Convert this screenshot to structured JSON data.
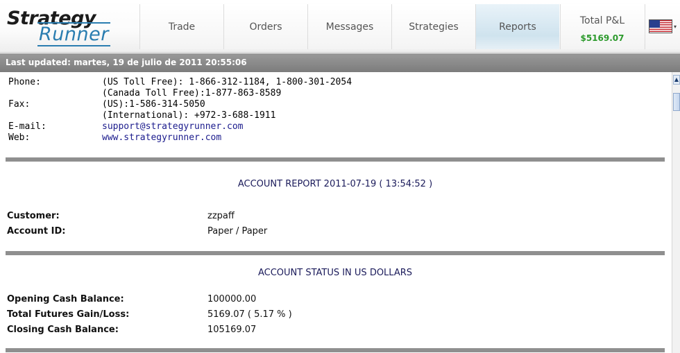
{
  "logo": {
    "line1": "Strategy",
    "line2": "Runner"
  },
  "nav": {
    "tabs": [
      {
        "label": "Trade"
      },
      {
        "label": "Orders"
      },
      {
        "label": "Messages"
      },
      {
        "label": "Strategies"
      },
      {
        "label": "Reports",
        "active": true
      }
    ],
    "total_pnl_label": "Total P&L",
    "total_pnl_value": "$5169.07",
    "flag": "us-flag-icon"
  },
  "status": {
    "last_updated": "Last updated: martes, 19 de julio de 2011 20:55:06"
  },
  "contact": {
    "phone_label": "Phone:",
    "phone_line1": "(US Toll Free): 1-866-312-1184, 1-800-301-2054",
    "phone_line2": "(Canada Toll Free):1-877-863-8589",
    "fax_label": "Fax:",
    "fax_line1": "(US):1-586-314-5050",
    "fax_line2": "(International): +972-3-688-1911",
    "email_label": "E-mail:",
    "email_value": "support@strategyrunner.com",
    "web_label": "Web:",
    "web_value": "www.strategyrunner.com"
  },
  "account_report": {
    "title": "ACCOUNT REPORT 2011-07-19 ( 13:54:52 )",
    "customer_label": "Customer:",
    "customer_value": "zzpaff",
    "account_id_label": "Account ID:",
    "account_id_value": "Paper / Paper"
  },
  "account_status": {
    "title": "ACCOUNT STATUS IN US DOLLARS",
    "opening_label": "Opening Cash Balance:",
    "opening_value": "100000.00",
    "futures_label": "Total Futures Gain/Loss:",
    "futures_value": "5169.07 ( 5.17 % )",
    "closing_label": "Closing Cash Balance:",
    "closing_value": "105169.07"
  },
  "colors": {
    "pnl": "#2c9a2c",
    "link": "#1a1a8c",
    "active_tab": "#cfe3ee"
  }
}
